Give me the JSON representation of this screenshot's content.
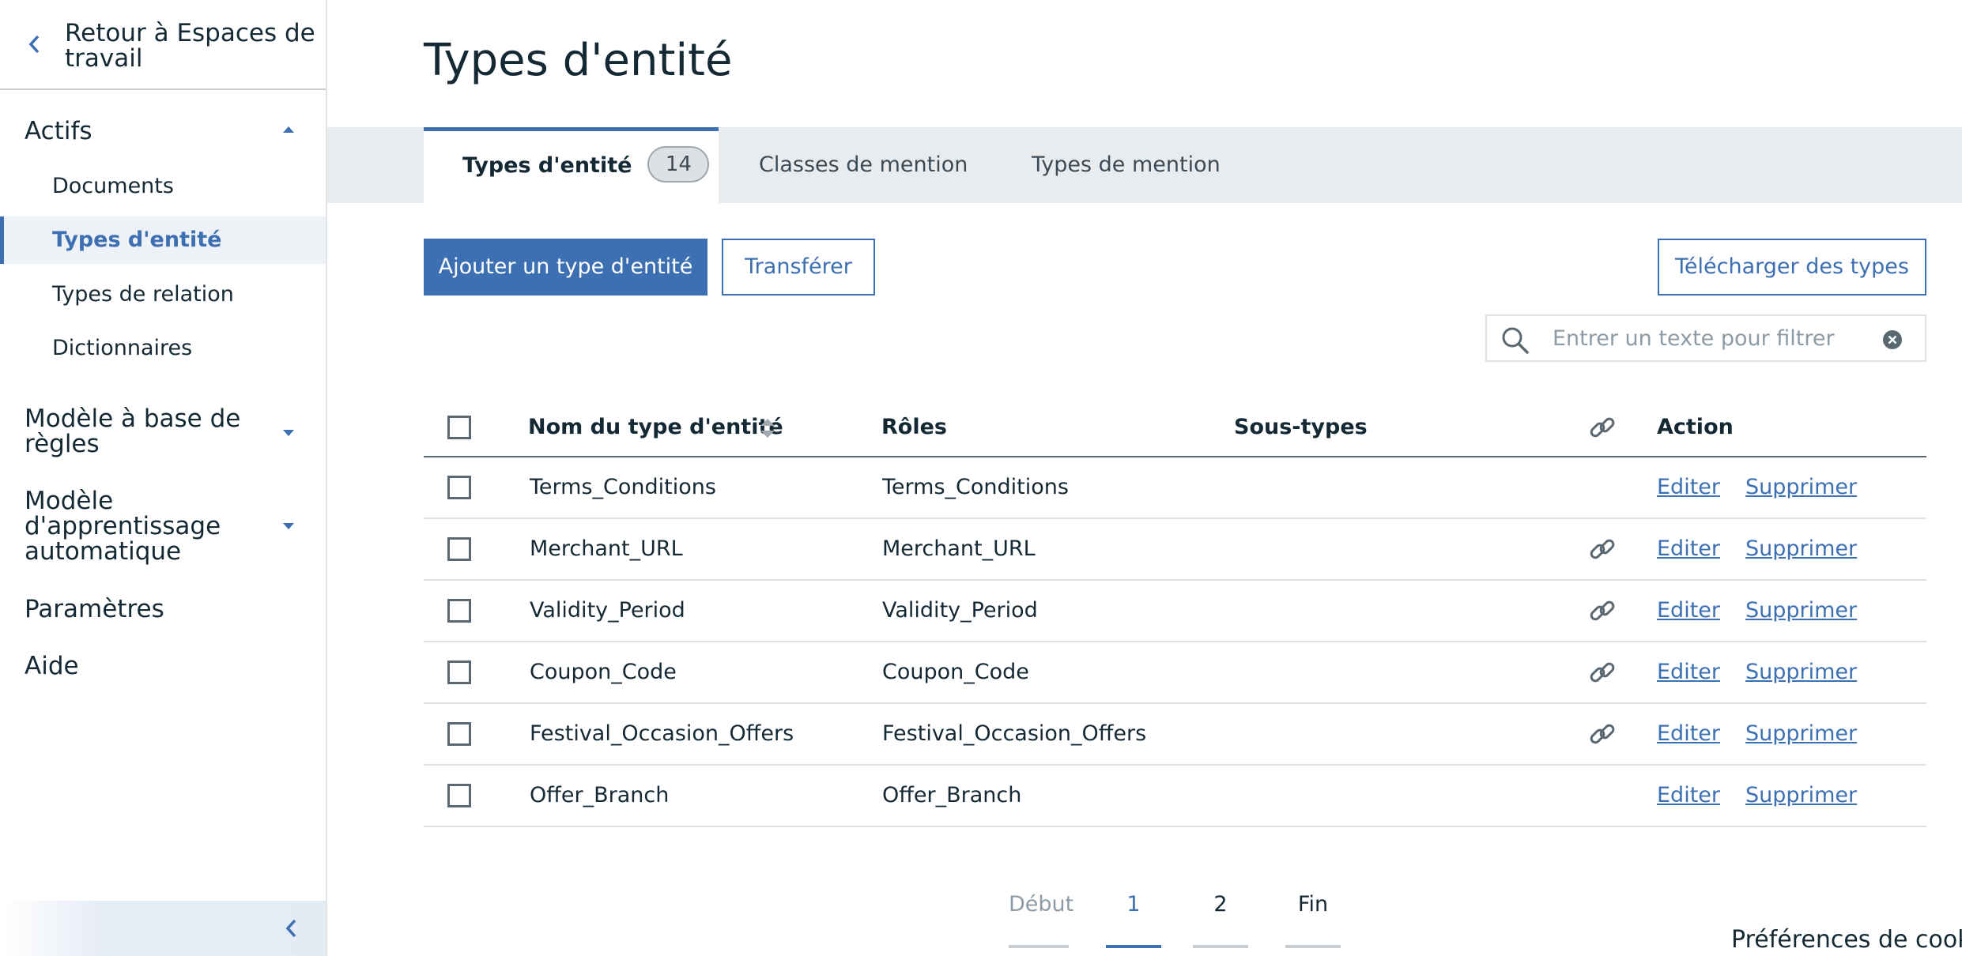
{
  "sidebar": {
    "back_label": "Retour à Espaces de travail",
    "sections": {
      "actifs": "Actifs",
      "rules_model": "Modèle à base de règles",
      "ml_model": "Modèle d'apprentissage automatique",
      "settings": "Paramètres",
      "help": "Aide"
    },
    "items": [
      {
        "label": "Documents"
      },
      {
        "label": "Types d'entité"
      },
      {
        "label": "Types de relation"
      },
      {
        "label": "Dictionnaires"
      }
    ]
  },
  "page": {
    "title": "Types d'entité"
  },
  "tabs": [
    {
      "label": "Types d'entité",
      "count": "14"
    },
    {
      "label": "Classes de mention"
    },
    {
      "label": "Types de mention"
    }
  ],
  "toolbar": {
    "add_label": "Ajouter un type d'entité",
    "transfer_label": "Transférer",
    "download_label": "Télécharger des types",
    "filter_placeholder": "Entrer un texte pour filtrer"
  },
  "table": {
    "headers": {
      "name": "Nom du type d'entité",
      "roles": "Rôles",
      "subtypes": "Sous-types",
      "action": "Action"
    },
    "edit_label": "Editer",
    "delete_label": "Supprimer",
    "rows": [
      {
        "name": "Terms_Conditions",
        "roles": "Terms_Conditions",
        "subtypes": "",
        "linked": false
      },
      {
        "name": "Merchant_URL",
        "roles": "Merchant_URL",
        "subtypes": "",
        "linked": true
      },
      {
        "name": "Validity_Period",
        "roles": "Validity_Period",
        "subtypes": "",
        "linked": true
      },
      {
        "name": "Coupon_Code",
        "roles": "Coupon_Code",
        "subtypes": "",
        "linked": true
      },
      {
        "name": "Festival_Occasion_Offers",
        "roles": "Festival_Occasion_Offers",
        "subtypes": "",
        "linked": true
      },
      {
        "name": "Offer_Branch",
        "roles": "Offer_Branch",
        "subtypes": "",
        "linked": false
      }
    ]
  },
  "pagination": {
    "first": "Début",
    "pages": [
      "1",
      "2"
    ],
    "current": "1",
    "last": "Fin"
  },
  "cookie_label": "Préférences de cook",
  "colors": {
    "accent": "#3d70b2",
    "text": "#152935",
    "tab_bg": "#e9ecee",
    "border": "#dfe3e6"
  }
}
